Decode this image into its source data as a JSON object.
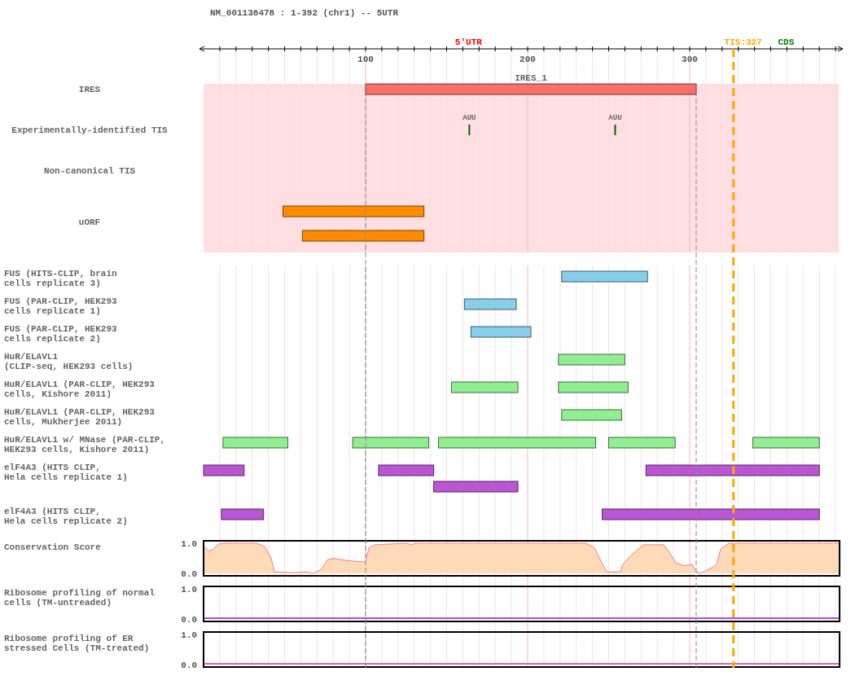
{
  "title": "NM_001136478 : 1-392 (chr1) -- 5UTR",
  "axis": {
    "regions": [
      {
        "label": "5'UTR",
        "color": "#ff0000"
      },
      {
        "label": "CDS",
        "color": "#008000"
      }
    ],
    "tis": {
      "label": "TIS:327",
      "color": "#ffa500"
    },
    "ticks": [
      "100",
      "200",
      "300"
    ]
  },
  "tracks": [
    {
      "label": "IRES",
      "kind": "features",
      "shaded": true,
      "color": "#f8706a",
      "features": [
        {
          "name": "IRES_1"
        }
      ]
    },
    {
      "label": "Experimentally-identified TIS",
      "kind": "sites",
      "shaded": true,
      "color": "#006400",
      "sites": [
        {
          "label": "AUU"
        },
        {
          "label": "AUU"
        }
      ]
    },
    {
      "label": "Non-canonical TIS",
      "kind": "sites",
      "shaded": true
    },
    {
      "label": "uORF",
      "kind": "features",
      "shaded": true,
      "color": "#ff8c00"
    },
    {
      "label": "FUS (HITS-CLIP, brain\ncells replicate 3)",
      "kind": "features",
      "shaded": false,
      "color": "#87ceeb"
    },
    {
      "label": "FUS (PAR-CLIP, HEK293\ncells replicate 1)",
      "kind": "features",
      "shaded": false,
      "color": "#87ceeb"
    },
    {
      "label": "FUS (PAR-CLIP, HEK293\ncells replicate 2)",
      "kind": "features",
      "shaded": false,
      "color": "#87ceeb"
    },
    {
      "label": "HuR/ELAVL1\n(CLIP-seq, HEK293 cells)",
      "kind": "features",
      "shaded": false,
      "color": "#90ee90"
    },
    {
      "label": "HuR/ELAVL1 (PAR-CLIP, HEK293\ncells, Kishore 2011)",
      "kind": "features",
      "shaded": false,
      "color": "#90ee90"
    },
    {
      "label": "HuR/ELAVL1 (PAR-CLIP, HEK293\ncells, Mukherjee 2011)",
      "kind": "features",
      "shaded": false,
      "color": "#90ee90"
    },
    {
      "label": "HuR/ELAVL1 w/ MNase (PAR-CLIP,\nHEK293 cells, Kishore 2011)",
      "kind": "features",
      "shaded": false,
      "color": "#90ee90"
    },
    {
      "label": "elF4A3 (HITS CLIP,\nHela cells replicate 1)",
      "kind": "features",
      "shaded": false,
      "color": "#ba55d3"
    },
    {
      "label": "elF4A3 (HITS CLIP,\nHela cells replicate 2)",
      "kind": "features",
      "shaded": false,
      "color": "#ba55d3"
    },
    {
      "label": "Conservation Score",
      "kind": "conservation",
      "color": "#f08080",
      "yticks": [
        "1.0",
        "0.0"
      ]
    },
    {
      "label": "Ribosome profiling of normal\ncells (TM-untreaded)",
      "kind": "flat",
      "color": "#b04fd8",
      "yticks": [
        "1.0",
        "0.0"
      ]
    },
    {
      "label": "Ribosome profiling of ER\nstressed Cells (TM-treated)",
      "kind": "flat",
      "color": "#e060b0",
      "yticks": [
        "1.0",
        "0.0"
      ]
    }
  ]
}
